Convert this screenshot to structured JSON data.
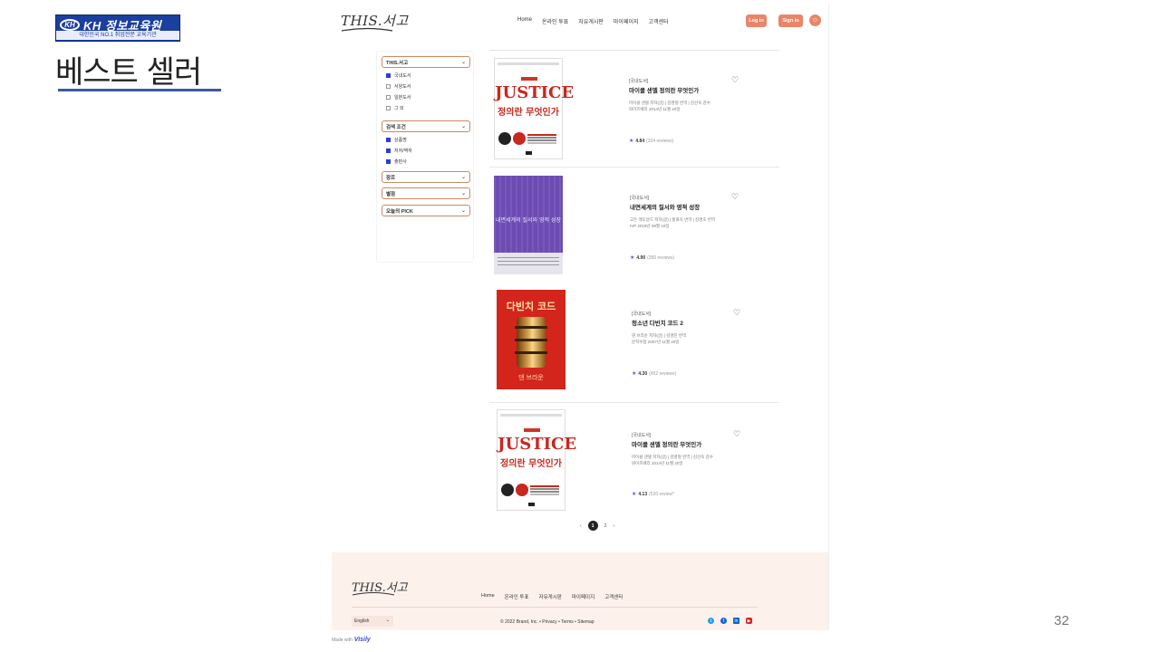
{
  "slide": {
    "logo_mark": "KH",
    "logo_brand": "KH 정보교육원",
    "logo_tagline": "대한민국 NO.1 취업전문 교육기관",
    "title": "베스트 셀러",
    "page_number": "32"
  },
  "site": {
    "logo": "THIS.서고",
    "nav": [
      "Home",
      "온라인 투표",
      "자유게시판",
      "마이페이지",
      "고객센터"
    ],
    "login_label": "Log in",
    "signin_label": "Sign in",
    "filters": {
      "groups": [
        {
          "label": "THIS.서고",
          "options": [
            {
              "label": "국내도서",
              "checked": true
            },
            {
              "label": "서양도서",
              "checked": false
            },
            {
              "label": "일본도서",
              "checked": false
            },
            {
              "label": "그 외",
              "checked": false
            }
          ]
        },
        {
          "label": "검색 조건",
          "options": [
            {
              "label": "상품명",
              "checked": true
            },
            {
              "label": "저자/역자",
              "checked": true
            },
            {
              "label": "출판사",
              "checked": true
            }
          ]
        },
        {
          "label": "장르",
          "options": []
        },
        {
          "label": "별점",
          "options": []
        },
        {
          "label": "오늘의 PICK",
          "options": []
        }
      ]
    },
    "books": [
      {
        "category": "[국내도서]",
        "title": "마이클 샌델 정의란 무엇인가",
        "meta1": "마이클 샌델 저자(글) | 김명철 번역 | 김선욱 감수",
        "meta2": "와이즈베리 2014년 11월 20일",
        "rating": "4.84",
        "reviews": "(324 reviews)",
        "cover_title": "JUSTICE",
        "cover_sub": "정의란 무엇인가"
      },
      {
        "category": "[국내도서]",
        "title": "내면세계의 질서와 영적 성장",
        "meta1": "고든 맥도날드 저자(글) | 홍화옥 번역 | 김명호 번역",
        "meta2": "IVP 2018년 08월 16일",
        "rating": "4.90",
        "reviews": "(350 reviews)",
        "cover_title": "내면세계의 질서와 영적 성장"
      },
      {
        "category": "[국내도서]",
        "title": "청소년 다빈치 코드 2",
        "meta1": "댄 브라운 저자(글) | 김명진 번역",
        "meta2": "문학수첩 2007년 11월 20일",
        "rating": "4.30",
        "reviews": "(452 reviews)",
        "cover_title": "다빈치 코드",
        "cover_author": "댄 브라운"
      },
      {
        "category": "[국내도서]",
        "title": "마이클 샌델 정의란 무엇인가",
        "meta1": "마이클 샌델 저자(글) | 김명철 번역 | 김선욱 감수",
        "meta2": "와이즈베리 2014년 11월 20일",
        "rating": "4.13",
        "reviews": "(520 review*",
        "cover_title": "JUSTICE",
        "cover_sub": "정의란 무엇인가"
      }
    ],
    "pagination": {
      "prev": "‹",
      "current": "1",
      "next_page": "2",
      "next": "›"
    },
    "footer": {
      "logo": "THIS.서고",
      "nav": [
        "Home",
        "온라인 투표",
        "자유게시판",
        "마이페이지",
        "고객센터"
      ],
      "language": "English",
      "copyright": "© 2022 Brand, Inc. • Privacy • Terms • Sitemap",
      "socials": [
        "twitter-icon",
        "facebook-icon",
        "linkedin-icon",
        "youtube-icon"
      ]
    },
    "made_with": "Made with",
    "made_with_brand": "Visily"
  }
}
